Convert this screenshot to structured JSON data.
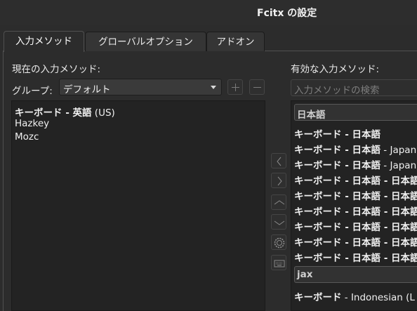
{
  "window": {
    "title": "Fcitx の設定"
  },
  "tabs": [
    {
      "label": "入力メソッド",
      "active": true
    },
    {
      "label": "グローバルオプション",
      "active": false
    },
    {
      "label": "アドオン",
      "active": false
    }
  ],
  "left": {
    "heading": "現在の入力メソッド:",
    "group_label": "グループ:",
    "group_value": "デフォルト",
    "items": [
      {
        "bold": "キーボード - 英語",
        "rest": " (US)"
      },
      {
        "bold": "",
        "rest": "Hazkey"
      },
      {
        "bold": "",
        "rest": "Mozc"
      }
    ]
  },
  "right": {
    "heading": "有効な入力メソッド:",
    "search_placeholder": "入力メソッドの検索",
    "group1": "日本語",
    "group1_items": [
      {
        "bold": "キーボード - 日本語",
        "rest": ""
      },
      {
        "bold": "キーボード - 日本語",
        "rest": " - Japan"
      },
      {
        "bold": "キーボード - 日本語",
        "rest": " - Japan"
      },
      {
        "bold": "キーボード - 日本語 - 日本語",
        "rest": ""
      },
      {
        "bold": "キーボード - 日本語 - 日本語",
        "rest": ""
      },
      {
        "bold": "キーボード - 日本語 - 日本語",
        "rest": ""
      },
      {
        "bold": "キーボード - 日本語 - 日本語",
        "rest": ""
      },
      {
        "bold": "キーボード - 日本語 - 日本語",
        "rest": ""
      },
      {
        "bold": "キーボード - 日本語 - 日本語",
        "rest": ""
      }
    ],
    "group2": "jax",
    "group2_items": [
      {
        "bold": "キーボード",
        "rest": " - Indonesian (L"
      }
    ]
  },
  "icons": {
    "add": "plus-icon",
    "remove": "minus-icon",
    "move_left": "chevron-left-icon",
    "move_right": "chevron-right-icon",
    "move_up": "chevron-up-icon",
    "move_down": "chevron-down-icon",
    "configure": "gear-icon",
    "keyboard": "keyboard-icon"
  }
}
